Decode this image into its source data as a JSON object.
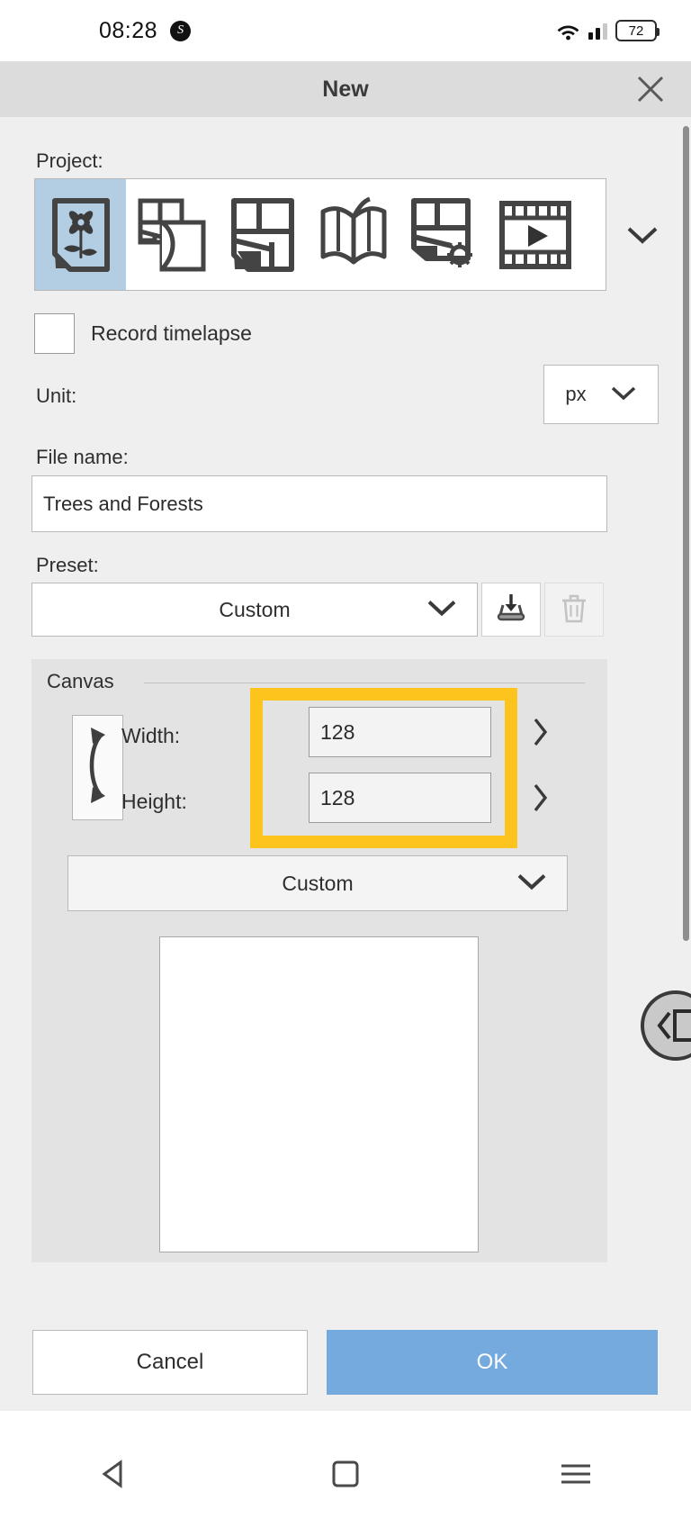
{
  "status_bar": {
    "time": "08:28",
    "app_badge": "S",
    "battery_percent": "72",
    "wifi_icon": "wifi-icon",
    "signal_icon": "cellular-signal-icon",
    "battery_icon": "battery-icon"
  },
  "dialog": {
    "title": "New",
    "close_icon": "close-icon"
  },
  "project": {
    "label": "Project:",
    "expand_icon": "chevron-down-icon",
    "items": [
      {
        "name": "single-image",
        "icon": "flower-photo-icon",
        "selected": true
      },
      {
        "name": "multi-page",
        "icon": "stacked-pages-icon",
        "selected": false
      },
      {
        "name": "grid-layout",
        "icon": "page-grid-icon",
        "selected": false
      },
      {
        "name": "book-spread",
        "icon": "open-book-icon",
        "selected": false
      },
      {
        "name": "template-settings",
        "icon": "page-gear-icon",
        "selected": false
      },
      {
        "name": "animation",
        "icon": "film-strip-icon",
        "selected": false
      }
    ]
  },
  "timelapse": {
    "label": "Record timelapse",
    "checked": false
  },
  "unit": {
    "label": "Unit:",
    "value": "px",
    "chevron_icon": "chevron-down-icon"
  },
  "file_name": {
    "label": "File name:",
    "value": "Trees and Forests",
    "placeholder": "File name"
  },
  "preset": {
    "label": "Preset:",
    "value": "Custom",
    "chevron_icon": "chevron-down-icon",
    "save_icon": "save-preset-icon",
    "delete_icon": "trash-icon",
    "delete_disabled": true
  },
  "canvas": {
    "legend": "Canvas",
    "swap_icon": "swap-dimensions-icon",
    "width_label": "Width:",
    "width_value": "128",
    "height_label": "Height:",
    "height_value": "128",
    "width_arrow_icon": "chevron-right-icon",
    "height_arrow_icon": "chevron-right-icon",
    "preset_value": "Custom",
    "preset_chevron_icon": "chevron-down-icon",
    "highlight_color": "#fcc41d"
  },
  "buttons": {
    "cancel": "Cancel",
    "ok": "OK",
    "ok_color": "#74aade"
  },
  "side_handle": {
    "icon": "panel-collapse-left-icon"
  },
  "nav_bar": {
    "back_icon": "triangle-back-icon",
    "home_icon": "square-home-icon",
    "recents_icon": "hamburger-recents-icon"
  }
}
